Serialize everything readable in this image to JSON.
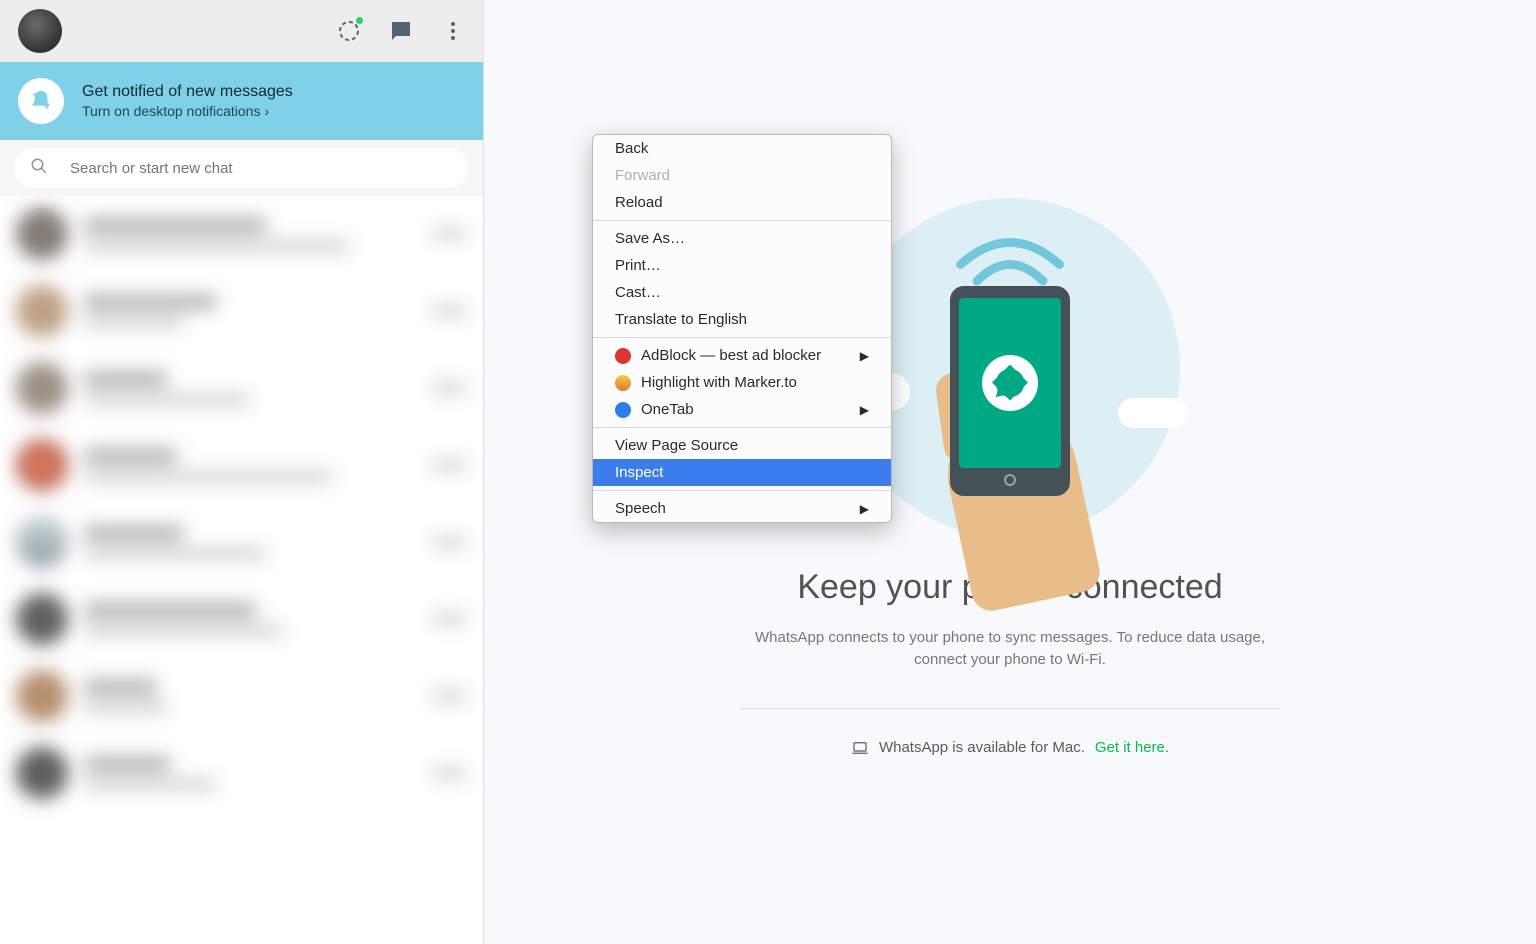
{
  "notif": {
    "title": "Get notified of new messages",
    "sub": "Turn on desktop notifications ›"
  },
  "search": {
    "placeholder": "Search or start new chat"
  },
  "main": {
    "title": "Keep your phone connected",
    "desc": "WhatsApp connects to your phone to sync messages. To reduce data usage, connect your phone to Wi-Fi.",
    "mac_text": "WhatsApp is available for Mac.",
    "mac_link": "Get it here."
  },
  "ctx": {
    "back": "Back",
    "forward": "Forward",
    "reload": "Reload",
    "saveas": "Save As…",
    "print": "Print…",
    "cast": "Cast…",
    "translate": "Translate to English",
    "adblock": "AdBlock — best ad blocker",
    "highlight": "Highlight with Marker.to",
    "onetab": "OneTab",
    "viewsource": "View Page Source",
    "inspect": "Inspect",
    "speech": "Speech"
  }
}
